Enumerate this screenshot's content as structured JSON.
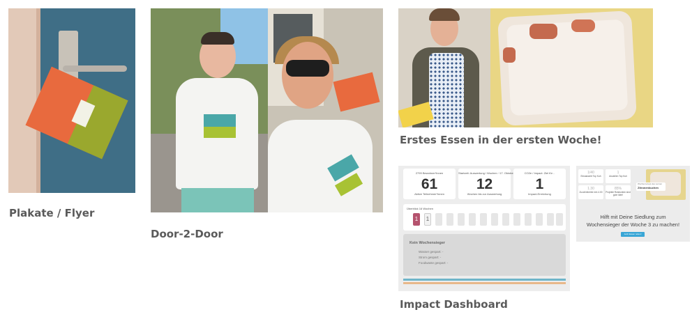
{
  "captions": {
    "plakate": "Plakate / Flyer",
    "door": "Door-2-Door",
    "essen": "Erstes Essen in der ersten Woche!",
    "impact": "Impact Dashboard"
  },
  "dashboard": {
    "kpis": [
      {
        "label": "2799 Bewohner*innen",
        "value": "61",
        "sub": "Aktive Teilnehmer*innen"
      },
      {
        "label": "Startzeit: Auswertung / Wochen ~17. Oktober",
        "value": "12",
        "sub": "Wochen bis zur Auswertung"
      },
      {
        "label": "CO2e / Impact: Ziel für ..",
        "value": "1",
        "sub": "Impact-Erreichung"
      }
    ],
    "weeks_title": "Überblick 16 Wochen",
    "weeks": [
      "1",
      "1",
      "",
      "",
      "",
      "",
      "",
      "",
      "",
      "",
      "",
      "",
      "",
      "",
      ""
    ],
    "no_winner_title": "Kein Wochensieger",
    "no_winner_lines": [
      "Wasser gespart: -",
      "Strom gespart: -",
      "Foodwaste gespart: -"
    ],
    "stripe_colors": [
      "#6fb5c9",
      "#e8b88a"
    ]
  },
  "mini": {
    "kpis": [
      {
        "n": "1/40",
        "s": "Einsatzwert Top Kuh"
      },
      {
        "n": "1",
        "s": "Anzahlen Top Kuh"
      },
      {
        "n": "1.30",
        "s": "Zucchinikörbe min 4.00"
      },
      {
        "n": "85%",
        "s": "Projekte Rotzkonten sind gute Idee!"
      }
    ],
    "pill_small": "Wochenrezept des Lernen",
    "pill_big": "Zitronenkuchen",
    "message_line1": "Hilft mit Deine Siedlung zum",
    "message_line2": "Wochensieger der Woche 3 zu machen!",
    "button": "Jetzt Essen retten!"
  }
}
